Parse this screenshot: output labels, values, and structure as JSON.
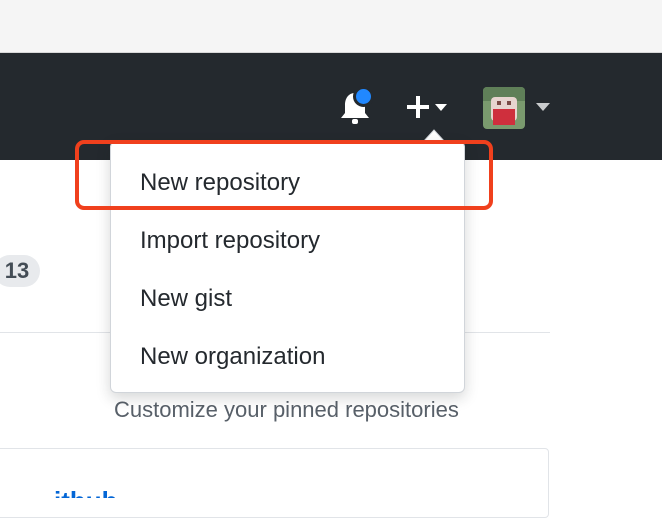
{
  "header": {
    "notifications_icon": "bell-icon",
    "create_icon": "plus-icon",
    "avatar_icon": "user-avatar"
  },
  "counter": {
    "value": "13"
  },
  "create_menu": {
    "items": [
      {
        "label": "New repository"
      },
      {
        "label": "Import repository"
      },
      {
        "label": "New gist"
      },
      {
        "label": "New organization"
      }
    ],
    "highlighted_item": "New repository"
  },
  "pinned": {
    "customize_label": "Customize your pinned repositories"
  },
  "colors": {
    "header_bg": "#24292e",
    "notification_dot": "#2188ff",
    "highlight_border": "#f0401d",
    "link": "#0366d6"
  }
}
